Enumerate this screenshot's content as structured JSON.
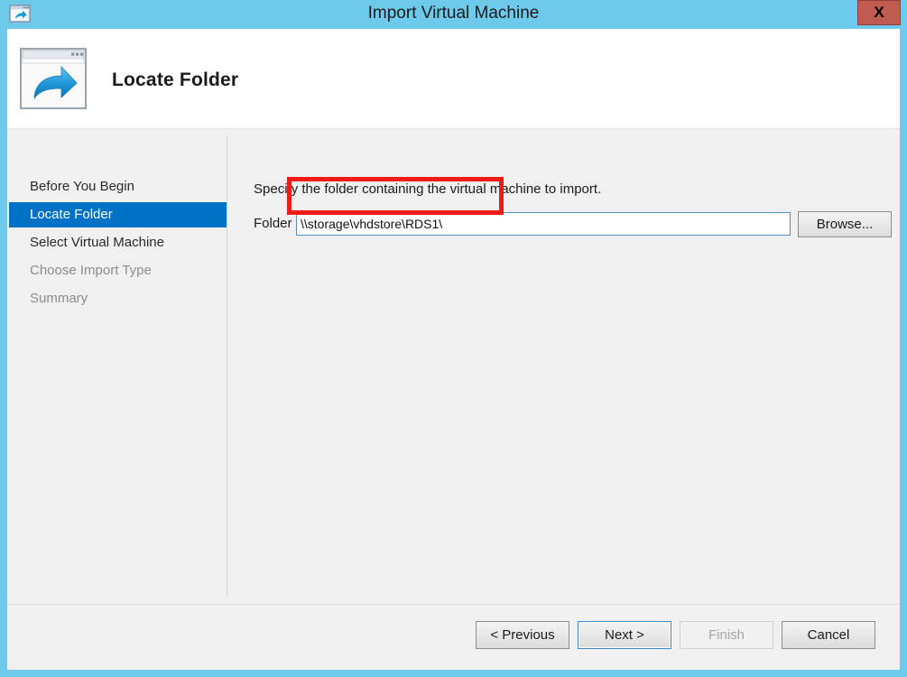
{
  "window": {
    "title": "Import Virtual Machine",
    "title_icon": "window-arrow-icon",
    "close_label": "X",
    "chrome_color": "#6ECAEA"
  },
  "header": {
    "title": "Locate Folder",
    "icon": "window-export-arrow-icon"
  },
  "sidebar": {
    "items": [
      {
        "label": "Before You Begin",
        "state": "normal"
      },
      {
        "label": "Locate Folder",
        "state": "selected"
      },
      {
        "label": "Select Virtual Machine",
        "state": "normal"
      },
      {
        "label": "Choose Import Type",
        "state": "dim"
      },
      {
        "label": "Summary",
        "state": "dim"
      }
    ],
    "selected_color": "#0072C6"
  },
  "content": {
    "instruction": "Specify the folder containing the virtual machine to import.",
    "folder_label": "Folder",
    "folder_value": "\\\\storage\\vhdstore\\RDS1\\",
    "folder_placeholder": "",
    "browse_label": "Browse..."
  },
  "annotation": {
    "color": "#EE1B17",
    "target": "folder-input"
  },
  "footer": {
    "buttons": [
      {
        "label": "< Previous",
        "state": "normal"
      },
      {
        "label": "Next >",
        "state": "focused"
      },
      {
        "label": "Finish",
        "state": "disabled"
      },
      {
        "label": "Cancel",
        "state": "normal"
      }
    ]
  }
}
